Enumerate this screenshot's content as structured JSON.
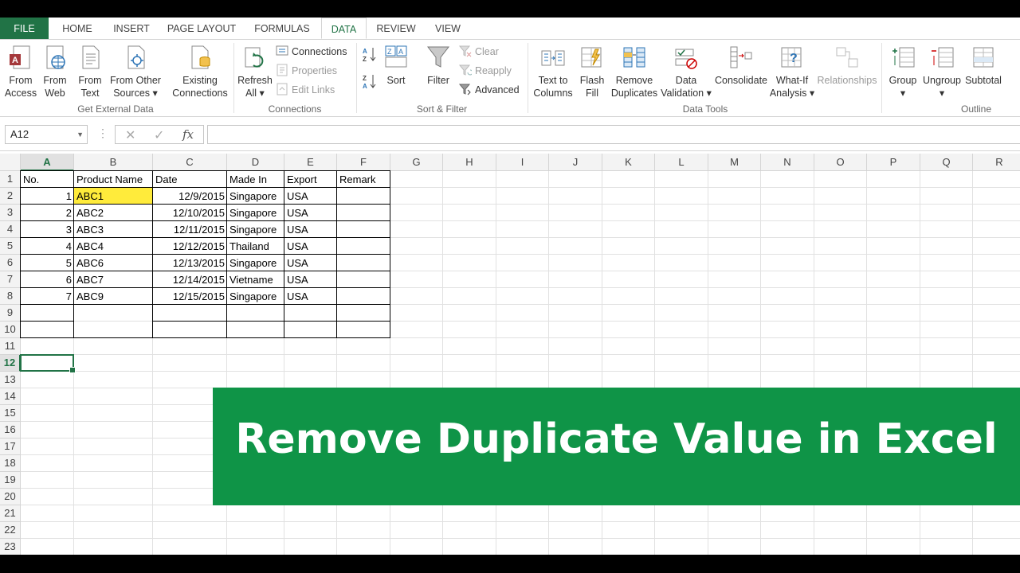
{
  "tabs": [
    "FILE",
    "HOME",
    "INSERT",
    "PAGE LAYOUT",
    "FORMULAS",
    "DATA",
    "REVIEW",
    "VIEW"
  ],
  "active_tab": "DATA",
  "ribbon": {
    "get_external": {
      "group_label": "Get External Data",
      "from_access": "From\nAccess",
      "from_web": "From\nWeb",
      "from_text": "From\nText",
      "from_other": "From Other\nSources ▾",
      "existing": "Existing\nConnections"
    },
    "connections": {
      "group_label": "Connections",
      "refresh": "Refresh\nAll ▾",
      "connections": "Connections",
      "properties": "Properties",
      "edit_links": "Edit Links"
    },
    "sort_filter": {
      "group_label": "Sort & Filter",
      "sort": "Sort",
      "filter": "Filter",
      "clear": "Clear",
      "reapply": "Reapply",
      "advanced": "Advanced"
    },
    "data_tools": {
      "group_label": "Data Tools",
      "text_to_columns": "Text to\nColumns",
      "flash_fill": "Flash\nFill",
      "remove_duplicates": "Remove\nDuplicates",
      "data_validation": "Data\nValidation ▾",
      "consolidate": "Consolidate",
      "what_if": "What-If\nAnalysis ▾",
      "relationships": "Relationships"
    },
    "outline": {
      "group_label": "Outline",
      "group": "Group\n▾",
      "ungroup": "Ungroup\n▾",
      "subtotal": "Subtotal"
    }
  },
  "formula_bar": {
    "name_box": "A12",
    "fx": "fx",
    "cancel": "✕",
    "enter": "✓",
    "dots": "⋮",
    "value": ""
  },
  "columns": [
    "A",
    "B",
    "C",
    "D",
    "E",
    "F",
    "G",
    "H",
    "I",
    "J",
    "K",
    "L",
    "M",
    "N",
    "O",
    "P",
    "Q",
    "R"
  ],
  "selected_column": "A",
  "rows": [
    "1",
    "2",
    "3",
    "4",
    "5",
    "6",
    "7",
    "8",
    "9",
    "10",
    "11",
    "12",
    "13",
    "14",
    "15",
    "16",
    "17",
    "18",
    "19",
    "20",
    "21",
    "22",
    "23"
  ],
  "selected_row": "12",
  "table": {
    "headers": [
      "No.",
      "Product Name",
      "Date",
      "Made In",
      "Export",
      "Remark"
    ],
    "rows": [
      [
        "1",
        "ABC1",
        "12/9/2015",
        "Singapore",
        "USA",
        ""
      ],
      [
        "2",
        "ABC2",
        "12/10/2015",
        "Singapore",
        "USA",
        ""
      ],
      [
        "3",
        "ABC3",
        "12/11/2015",
        "Singapore",
        "USA",
        ""
      ],
      [
        "4",
        "ABC4",
        "12/12/2015",
        "Thailand",
        "USA",
        ""
      ],
      [
        "5",
        "ABC6",
        "12/13/2015",
        "Singapore",
        "USA",
        ""
      ],
      [
        "6",
        "ABC7",
        "12/14/2015",
        "Vietname",
        "USA",
        ""
      ],
      [
        "7",
        "ABC9",
        "12/15/2015",
        "Singapore",
        "USA",
        ""
      ]
    ],
    "highlight_color": "#ffeb3b"
  },
  "banner": {
    "text": "Remove Duplicate Value in Excel",
    "bg": "#0f9447"
  },
  "colors": {
    "accent": "#217346"
  }
}
